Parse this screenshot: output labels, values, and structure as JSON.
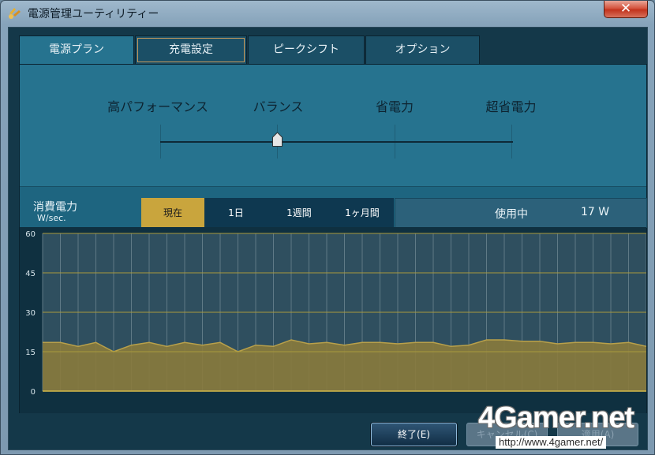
{
  "window": {
    "title": "電源管理ユーティリティー",
    "close_label": "✕"
  },
  "tabs": [
    {
      "label": "電源プラン",
      "state": "active"
    },
    {
      "label": "充電設定",
      "state": "focused"
    },
    {
      "label": "ピークシフト",
      "state": "normal"
    },
    {
      "label": "オプション",
      "state": "normal"
    }
  ],
  "power_plan": {
    "options": [
      "高パフォーマンス",
      "バランス",
      "省電力",
      "超省電力"
    ],
    "selected": "バランス"
  },
  "consumption": {
    "title": "消費電力",
    "unit": "W/sec.",
    "ranges": [
      "現在",
      "1日",
      "1週間",
      "1ヶ月間"
    ],
    "selected_range": "現在",
    "status_label": "使用中",
    "status_value": "17 W"
  },
  "chart_data": {
    "type": "area",
    "y_ticks": [
      "60",
      "45",
      "30",
      "15",
      "0"
    ],
    "ylim": [
      0,
      60
    ],
    "grid": true,
    "values": [
      18.5,
      18.5,
      17,
      18.5,
      15,
      17.5,
      18.5,
      17,
      18.5,
      17.5,
      18.5,
      15,
      17.5,
      17,
      19.5,
      18,
      18.5,
      17.5,
      18.5,
      18.5,
      18,
      18.5,
      18.5,
      17,
      17.5,
      19.5,
      19.5,
      19,
      19,
      18,
      18.5,
      18.5,
      18,
      18.5,
      17
    ],
    "fill_color": "#8a7a3c",
    "grid_color": "#a89a3c",
    "background": "#2f4f5f"
  },
  "buttons": {
    "ok_label": "終了(E)",
    "cancel_label": "キャンセル(C)",
    "apply_label": "適用(A)"
  },
  "watermark": {
    "logo": "4Gamer.net",
    "url": "http://www.4gamer.net/"
  }
}
